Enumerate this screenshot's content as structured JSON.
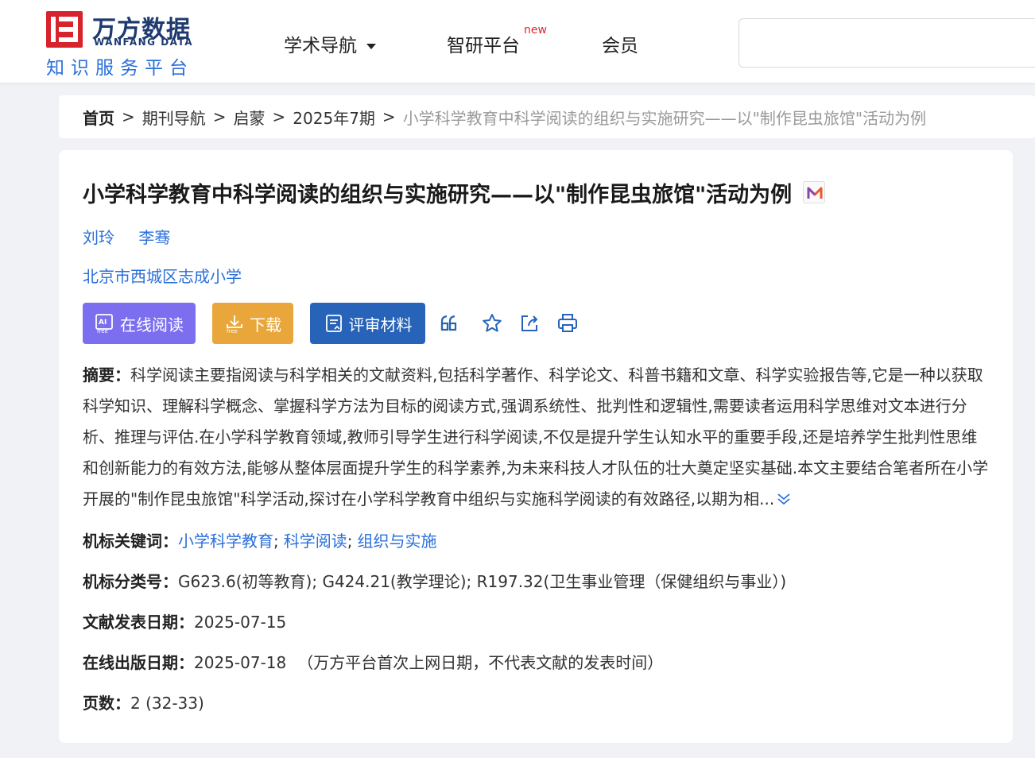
{
  "header": {
    "logo": {
      "cn_name": "万方数据",
      "en_name": "WANFANG DATA",
      "slogan": "知识服务平台"
    },
    "nav": [
      {
        "label": "学术导航",
        "has_dropdown": true
      },
      {
        "label": "智研平台",
        "badge": "new"
      },
      {
        "label": "会员"
      }
    ],
    "search": {
      "value": "",
      "placeholder": ""
    }
  },
  "breadcrumb": [
    {
      "label": "首页"
    },
    {
      "label": "期刊导航"
    },
    {
      "label": "启蒙"
    },
    {
      "label": "2025年7期"
    },
    {
      "label": "小学科学教育中科学阅读的组织与实施研究——以\"制作昆虫旅馆\"活动为例"
    }
  ],
  "breadcrumb_sep": ">",
  "article": {
    "title": "小学科学教育中科学阅读的组织与实施研究——以\"制作昆虫旅馆\"活动为例",
    "authors": [
      "刘玲",
      "李骞"
    ],
    "organization": "北京市西城区志成小学",
    "actions": {
      "read_online": "在线阅读",
      "download": "下载",
      "review_material": "评审材料"
    },
    "tool_icons": [
      "cite-icon",
      "favorite-icon",
      "share-icon",
      "print-icon"
    ],
    "abstract_label": "摘要：",
    "abstract": "科学阅读主要指阅读与科学相关的文献资料,包括科学著作、科学论文、科普书籍和文章、科学实验报告等,它是一种以获取科学知识、理解科学概念、掌握科学方法为目标的阅读方式,强调系统性、批判性和逻辑性,需要读者运用科学思维对文本进行分析、推理与评估.在小学科学教育领域,教师引导学生进行科学阅读,不仅是提升学生认知水平的重要手段,还是培养学生批判性思维和创新能力的有效方法,能够从整体层面提升学生的科学素养,为未来科技人才队伍的壮大奠定坚实基础.本文主要结合笔者所在小学开展的\"制作昆虫旅馆\"科学活动,探讨在小学科学教育中组织与实施科学阅读的有效路径,以期为相...",
    "keywords_label": "机标关键词：",
    "keywords": [
      "小学科学教育",
      "科学阅读",
      "组织与实施"
    ],
    "keyword_sep": ";",
    "classification_label": "机标分类号：",
    "classification": "G623.6(初等教育); G424.21(教学理论); R197.32(卫生事业管理（保健组织与事业）)",
    "pub_date_label": "文献发表日期：",
    "pub_date": "2025-07-15",
    "online_date_label": "在线出版日期：",
    "online_date": "2025-07-18",
    "online_date_note": "（万方平台首次上网日期，不代表文献的发表时间）",
    "pages_label": "页数：",
    "pages": "2 (32-33)"
  },
  "colors": {
    "brand_red": "#d7232c",
    "brand_navy": "#1e3a6e",
    "link_blue": "#2a6fdb",
    "read_button": "#7b6ff0",
    "download_button": "#e9a73b",
    "review_button": "#2763b8"
  }
}
